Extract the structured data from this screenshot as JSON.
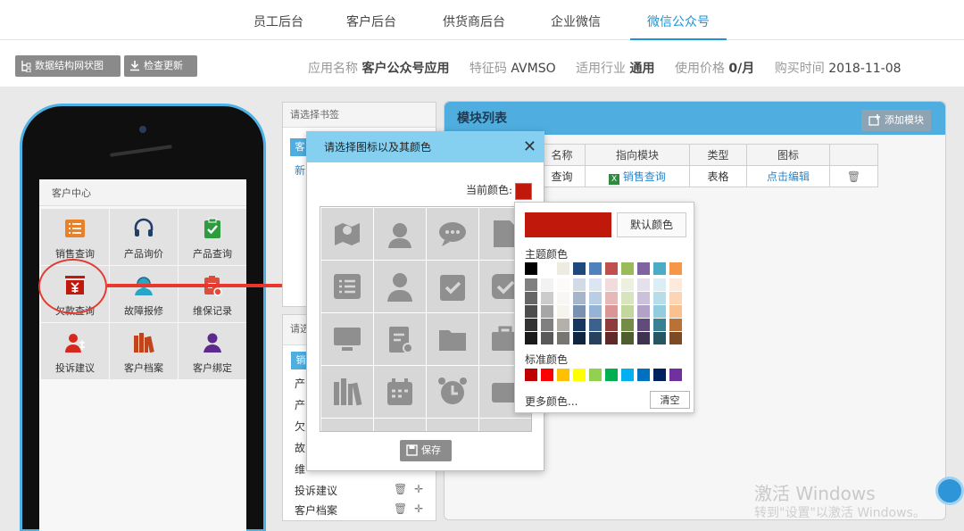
{
  "nav": {
    "tabs": [
      {
        "label": "员工后台"
      },
      {
        "label": "客户后台"
      },
      {
        "label": "供货商后台"
      },
      {
        "label": "企业微信"
      },
      {
        "label": "微信公众号",
        "active": true
      }
    ]
  },
  "toolbar": {
    "structure_label": "数据结构网状图",
    "update_label": "检查更新"
  },
  "info": {
    "app_name_label": "应用名称",
    "app_name": "客户公众号应用",
    "code_label": "特征码",
    "code": "AVMSO",
    "industry_label": "适用行业",
    "industry": "通用",
    "price_label": "使用价格",
    "price": "0/月",
    "purchase_label": "购买时间",
    "purchase": "2018-11-08"
  },
  "phone": {
    "title": "客户中心",
    "items": [
      {
        "label": "销售查询",
        "icon": "list-icon",
        "color": "#e7812a"
      },
      {
        "label": "产品询价",
        "icon": "headset-icon",
        "color": "#1f3f66"
      },
      {
        "label": "产品查询",
        "icon": "clipboard-check-icon",
        "color": "#2e9c3e"
      },
      {
        "label": "欠款查询",
        "icon": "yen-box-icon",
        "color": "#c0190c"
      },
      {
        "label": "故障报修",
        "icon": "support-agent-icon",
        "color": "#2aa5c8"
      },
      {
        "label": "维保记录",
        "icon": "clipboard-gear-icon",
        "color": "#e04c3c"
      },
      {
        "label": "投诉建议",
        "icon": "user-plus-icon",
        "color": "#d6281c"
      },
      {
        "label": "客户档案",
        "icon": "books-icon",
        "color": "#c0441c"
      },
      {
        "label": "客户绑定",
        "icon": "user-icon",
        "color": "#5b2a8c"
      }
    ]
  },
  "bookmark": {
    "header": "请选择书签",
    "tab_partial": "客",
    "new_partial": "新",
    "header2_partial": "请选",
    "tab2_partial": "销",
    "list": [
      {
        "label": "产"
      },
      {
        "label": "产"
      },
      {
        "label": "欠"
      },
      {
        "label": "故"
      },
      {
        "label": "维"
      },
      {
        "label": "投诉建议"
      },
      {
        "label": "客户档案"
      }
    ]
  },
  "module_list": {
    "title": "模块列表",
    "add_label": "添加模块",
    "columns": [
      "名称",
      "指向模块",
      "类型",
      "图标"
    ],
    "row": {
      "name": "查询",
      "target": "销售查询",
      "type": "表格",
      "icon": "点击编辑"
    }
  },
  "icon_dialog": {
    "title": "请选择图标以及其颜色",
    "current_color_label": "当前颜色:",
    "current_color": "#c0190c",
    "save_label": "保存"
  },
  "color_picker": {
    "default_label": "默认颜色",
    "theme_label": "主题颜色",
    "standard_label": "标准颜色",
    "more_label": "更多颜色...",
    "clear_label": "清空",
    "theme_top": [
      "#000000",
      "#ffffff",
      "#eeece1",
      "#1f497d",
      "#4f81bd",
      "#c0504d",
      "#9bbb59",
      "#8064a2",
      "#4bacc6",
      "#f79646"
    ],
    "standard": [
      "#c00000",
      "#ff0000",
      "#ffc000",
      "#ffff00",
      "#92d050",
      "#00b050",
      "#00b0f0",
      "#0070c0",
      "#002060",
      "#7030a0"
    ]
  },
  "watermark": {
    "line1": "激活 Windows",
    "line2": "转到\"设置\"以激活 Windows。"
  }
}
